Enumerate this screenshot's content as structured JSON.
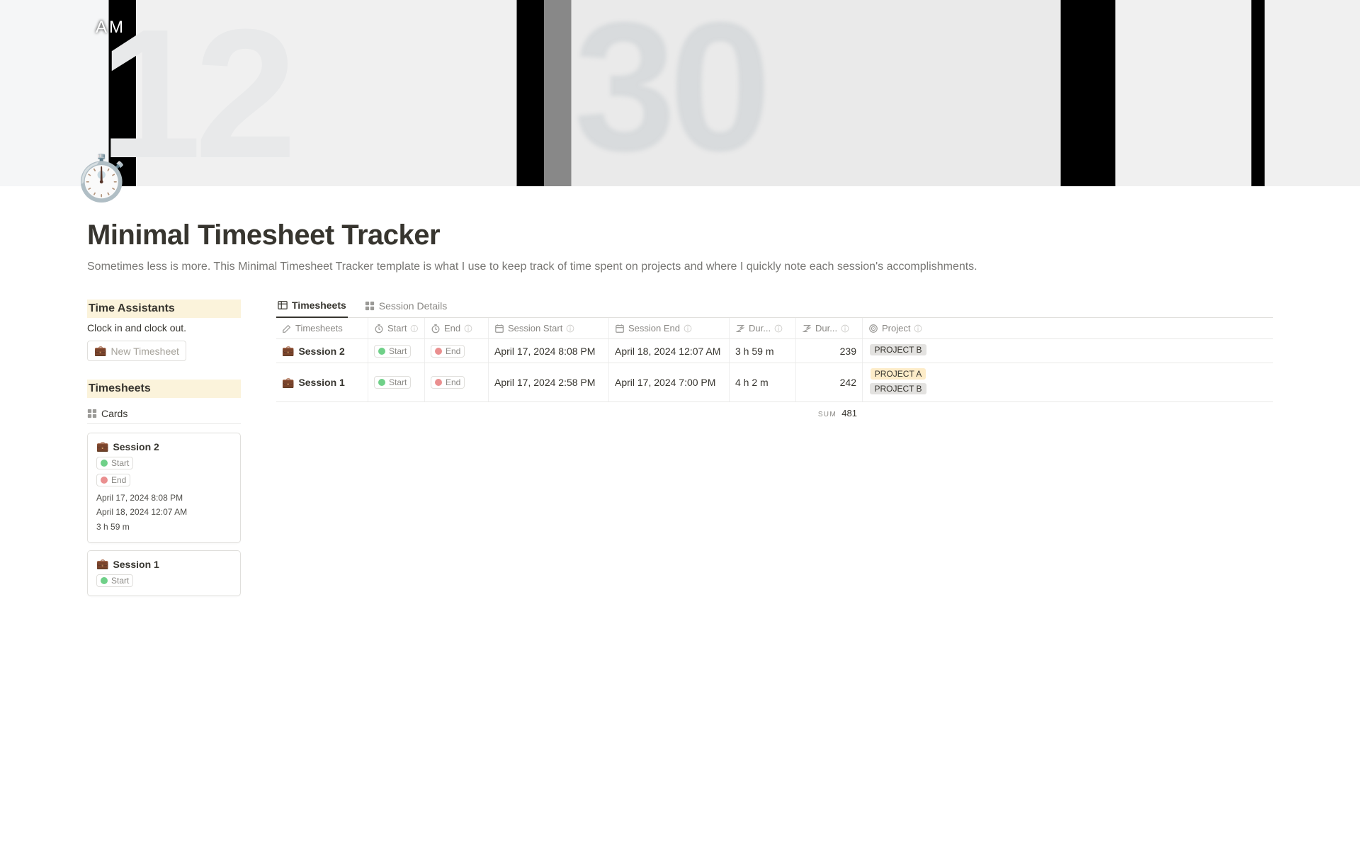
{
  "page": {
    "icon": "⏱️",
    "title": "Minimal Timesheet Tracker",
    "description": "Sometimes less is more. This Minimal Timesheet Tracker template is what I use to keep track of time spent on projects and where I quickly note each session's accomplishments.",
    "cover_text_hour": "12",
    "cover_text_min": "30",
    "cover_ampm": "AM"
  },
  "sidebar": {
    "time_assistants_heading": "Time Assistants",
    "clock_in_out": "Clock in and clock out.",
    "new_timesheet_btn": "New Timesheet",
    "new_timesheet_icon": "💼",
    "timesheets_heading": "Timesheets",
    "cards_view_label": "Cards",
    "cards": [
      {
        "icon": "💼",
        "title": "Session 2",
        "start_label": "Start",
        "end_label": "End",
        "meta1": "April 17, 2024 8:08 PM",
        "meta2": "April 18, 2024 12:07 AM",
        "meta3": "3 h 59 m"
      },
      {
        "icon": "💼",
        "title": "Session 1",
        "start_label": "Start",
        "end_label": "",
        "meta1": "",
        "meta2": "",
        "meta3": ""
      }
    ]
  },
  "tabs": {
    "timesheets": "Timesheets",
    "session_details": "Session Details"
  },
  "table": {
    "headers": {
      "timesheets": "Timesheets",
      "start": "Start",
      "end": "End",
      "session_start": "Session Start",
      "session_end": "Session End",
      "dur1": "Dur...",
      "dur2": "Dur...",
      "project": "Project"
    },
    "rows": [
      {
        "icon": "💼",
        "name": "Session 2",
        "start_btn": "Start",
        "end_btn": "End",
        "session_start": "April 17, 2024 8:08 PM",
        "session_end": "April 18, 2024 12:07 AM",
        "dur1": "3 h 59 m",
        "dur2": "239",
        "projects": [
          {
            "label": "PROJECT B",
            "cls": "tag-b"
          }
        ]
      },
      {
        "icon": "💼",
        "name": "Session 1",
        "start_btn": "Start",
        "end_btn": "End",
        "session_start": "April 17, 2024 2:58 PM",
        "session_end": "April 17, 2024 7:00 PM",
        "dur1": "4 h 2 m",
        "dur2": "242",
        "projects": [
          {
            "label": "PROJECT A",
            "cls": "tag-a"
          },
          {
            "label": "PROJECT B",
            "cls": "tag-b"
          }
        ]
      }
    ],
    "sum_label": "SUM",
    "sum_value": "481"
  }
}
